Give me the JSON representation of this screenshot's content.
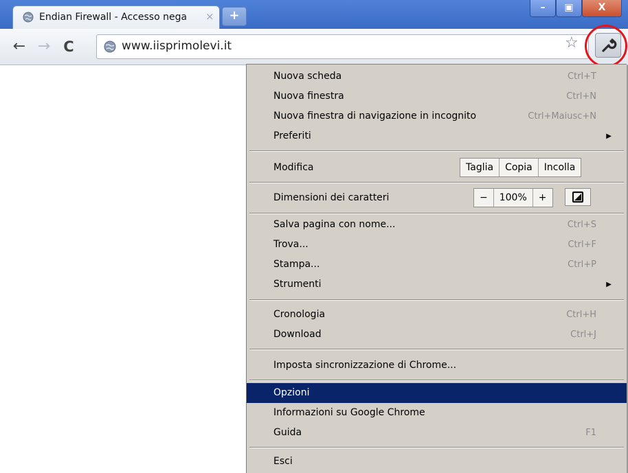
{
  "browser": {
    "tab_title": "Endian Firewall - Accesso nega",
    "tab_close": "×",
    "new_tab": "+",
    "url": "www.iisprimolevi.it",
    "window_controls": {
      "minimize": "–",
      "maximize": "▣",
      "close": "X"
    },
    "nav": {
      "back": "←",
      "forward": "→",
      "reload": "C"
    },
    "star": "☆"
  },
  "menu": {
    "items": [
      {
        "label": "Nuova scheda",
        "shortcut": "Ctrl+T"
      },
      {
        "label": "Nuova finestra",
        "shortcut": "Ctrl+N"
      },
      {
        "label": "Nuova finestra di navigazione in incognito",
        "shortcut": "Ctrl+Maiusc+N"
      },
      {
        "label": "Preferiti",
        "submenu": "▶"
      },
      {
        "label": "Modifica"
      },
      {
        "label": "Dimensioni dei caratteri"
      },
      {
        "label": "Salva pagina con nome...",
        "shortcut": "Ctrl+S"
      },
      {
        "label": "Trova...",
        "shortcut": "Ctrl+F"
      },
      {
        "label": "Stampa...",
        "shortcut": "Ctrl+P"
      },
      {
        "label": "Strumenti",
        "submenu": "▶"
      },
      {
        "label": "Cronologia",
        "shortcut": "Ctrl+H"
      },
      {
        "label": "Download",
        "shortcut": "Ctrl+J"
      },
      {
        "label": "Imposta sincronizzazione di Chrome..."
      },
      {
        "label": "Opzioni"
      },
      {
        "label": "Informazioni su Google Chrome"
      },
      {
        "label": "Guida",
        "shortcut": "F1"
      },
      {
        "label": "Esci"
      }
    ],
    "edit": {
      "cut": "Taglia",
      "copy": "Copia",
      "paste": "Incolla"
    },
    "zoom": {
      "minus": "−",
      "level": "100%",
      "plus": "+"
    }
  },
  "colors": {
    "highlight": "#0a246a",
    "menu_bg": "#d4d0c8",
    "annotation_ring": "#e3141b"
  }
}
